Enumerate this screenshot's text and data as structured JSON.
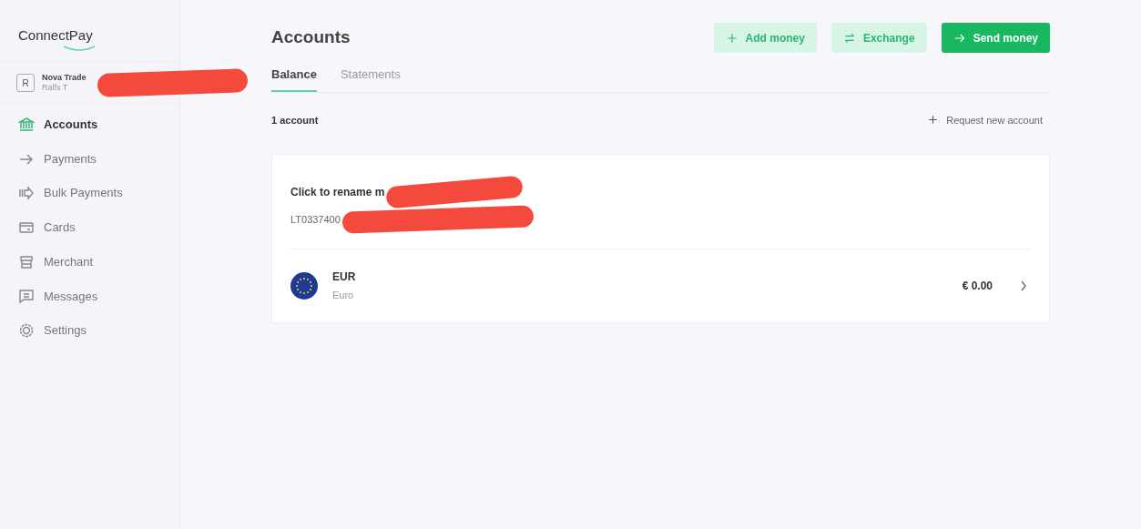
{
  "logo": "ConnectPay",
  "company": {
    "initial": "R",
    "name": "Nova Trade",
    "user": "Ralfs T"
  },
  "sidebar": {
    "items": [
      {
        "label": "Accounts",
        "selected": true
      },
      {
        "label": "Payments",
        "selected": false
      },
      {
        "label": "Bulk Payments",
        "selected": false
      },
      {
        "label": "Cards",
        "selected": false
      },
      {
        "label": "Merchant",
        "selected": false
      },
      {
        "label": "Messages",
        "selected": false
      },
      {
        "label": "Settings",
        "selected": false
      }
    ]
  },
  "page_title": "Accounts",
  "actions": [
    {
      "label": "Add money",
      "kind": "light"
    },
    {
      "label": "Exchange",
      "kind": "light"
    },
    {
      "label": "Send money",
      "kind": "solid"
    }
  ],
  "tabs": [
    {
      "label": "Balance",
      "selected": true
    },
    {
      "label": "Statements",
      "selected": false
    }
  ],
  "account_count": "1 account",
  "request_link": {
    "label": "Request new account"
  },
  "account": {
    "name": "Click to rename m",
    "iban": "LT0337400",
    "currencies": [
      {
        "code": "EUR",
        "name": "Euro",
        "balance": "€ 0.00"
      }
    ]
  }
}
